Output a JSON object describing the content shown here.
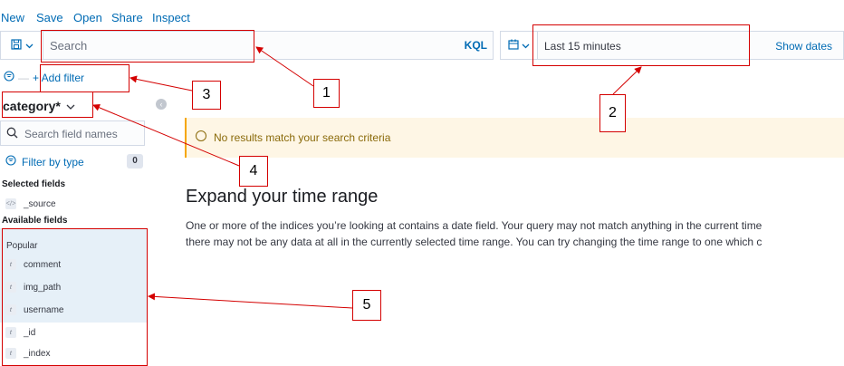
{
  "menu": [
    "New",
    "Save",
    "Open",
    "Share",
    "Inspect"
  ],
  "query_bar": {
    "search_placeholder": "Search",
    "language": "KQL"
  },
  "time_bar": {
    "range": "Last 15 minutes",
    "show_dates": "Show dates"
  },
  "filter": {
    "add_label": "+ Add filter"
  },
  "sidebar": {
    "index_pattern": "category*",
    "field_search_placeholder": "Search field names",
    "filter_by_type": "Filter by type",
    "filter_count": "0",
    "selected_title": "Selected fields",
    "selected_fields": [
      {
        "name": "_source",
        "type": "source"
      }
    ],
    "available_title": "Available fields",
    "popular_title": "Popular",
    "popular_fields": [
      {
        "name": "comment",
        "type": "t"
      },
      {
        "name": "img_path",
        "type": "t"
      },
      {
        "name": "username",
        "type": "t"
      }
    ],
    "other_fields": [
      {
        "name": "_id",
        "type": "t"
      },
      {
        "name": "_index",
        "type": "t"
      }
    ]
  },
  "main": {
    "callout": "No results match your search criteria",
    "title": "Expand your time range",
    "body_line1": "One or more of the indices you’re looking at contains a date field. Your query may not match anything in the current time",
    "body_line2": "there may not be any data at all in the currently selected time range. You can try changing the time range to one which c"
  },
  "annotations": [
    "1",
    "2",
    "3",
    "4",
    "5"
  ],
  "colors": {
    "link": "#006bb4",
    "annotation": "#d40000",
    "callout_bg": "#fef6e5",
    "popular_bg": "#e6f0f8"
  }
}
